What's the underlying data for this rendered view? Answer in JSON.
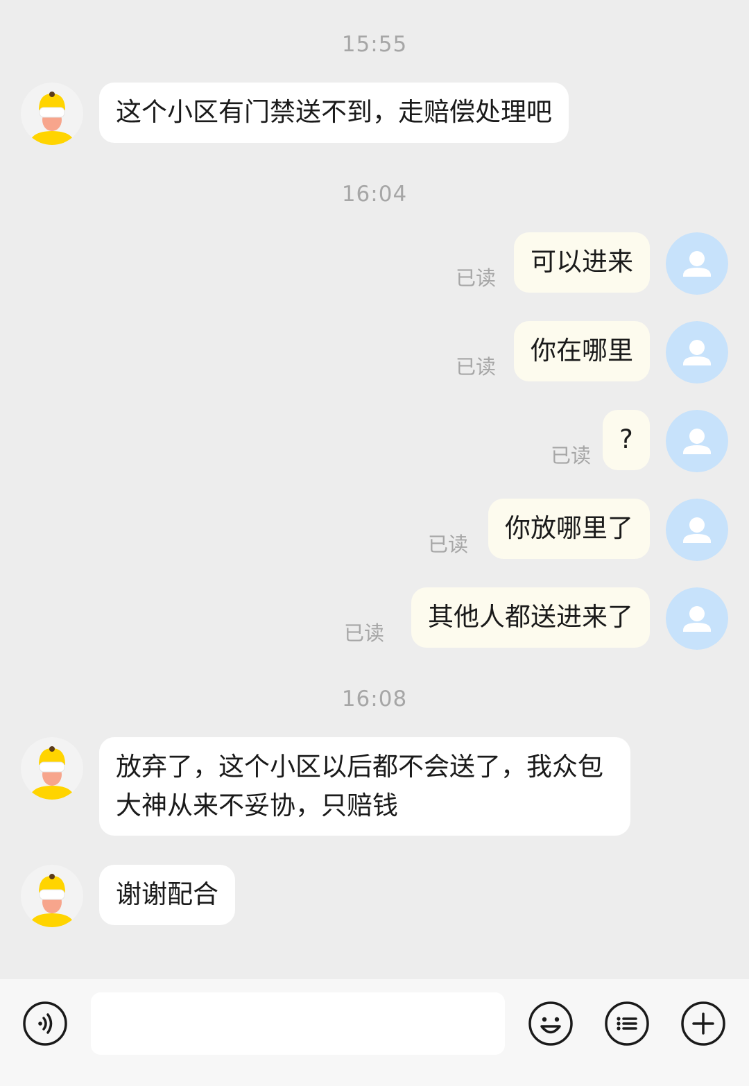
{
  "conversation": {
    "timestamps": [
      "15:55",
      "16:04",
      "16:08"
    ],
    "incoming": [
      {
        "text": "这个小区有门禁送不到，走赔偿处理吧"
      },
      {
        "text": "放弃了，这个小区以后都不会送了，我众包大神从来不妥协，只赔钱"
      },
      {
        "text": "谢谢配合"
      }
    ],
    "outgoing": [
      {
        "text": "可以进来",
        "status": "已读"
      },
      {
        "text": "你在哪里",
        "status": "已读"
      },
      {
        "text": "?",
        "status": "已读"
      },
      {
        "text": "你放哪里了",
        "status": "已读"
      },
      {
        "text": "其他人都送进来了",
        "status": "已读"
      }
    ]
  },
  "input_bar": {
    "icons": [
      "voice-icon",
      "emoji-icon",
      "quick-reply-icon",
      "add-icon"
    ],
    "message_value": ""
  },
  "colors": {
    "background": "#ededed",
    "incoming_bubble": "#ffffff",
    "outgoing_bubble": "#fdfbee",
    "user_avatar": "#c7e2fb",
    "courier_helmet": "#ffd400"
  }
}
